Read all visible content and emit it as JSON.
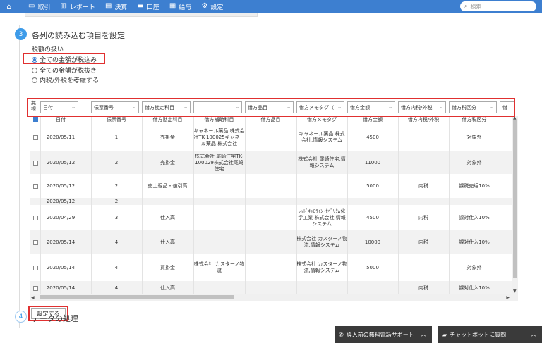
{
  "nav": {
    "items": [
      {
        "icon": "screen-icon",
        "glyph": "▭",
        "label": "取引"
      },
      {
        "icon": "report-icon",
        "glyph": "▥",
        "label": "レポート"
      },
      {
        "icon": "book-icon",
        "glyph": "▤",
        "label": "決算"
      },
      {
        "icon": "card-icon",
        "glyph": "▬",
        "label": "口座"
      },
      {
        "icon": "doc-icon",
        "glyph": "▦",
        "label": "給与"
      },
      {
        "icon": "gear-icon",
        "glyph": "⚙",
        "label": "設定"
      }
    ],
    "search_placeholder": "検索"
  },
  "step3": {
    "number": "3",
    "title": "各列の読み込む項目を設定"
  },
  "tax": {
    "label": "税額の扱い",
    "options": [
      "全ての金額が税込み",
      "全ての金額が税抜き",
      "内税/外税を考慮する"
    ],
    "selected": 0
  },
  "table": {
    "mu_label": "無視",
    "filters": [
      "日付",
      "伝票番号",
      "借方勘定科目",
      "",
      "借方品目",
      "借方メモタグ（",
      "借方金額",
      "借方内税/外税",
      "借方税区分",
      "借"
    ],
    "headers": [
      "日付",
      "伝票番号",
      "借方勘定科目",
      "借方補助科目",
      "借方品目",
      "借方メモタグ",
      "借方金額",
      "借方内税/外税",
      "借方税区分"
    ],
    "rows": [
      {
        "cells": [
          "2020/05/11",
          "1",
          "売掛金",
          "キャネール薬品 株式会社TK-100025キャネール薬品 株式会社",
          "",
          "キャネール薬品 株式会社,情報システム",
          "4500",
          "",
          "対象外"
        ]
      },
      {
        "cells": [
          "2020/05/12",
          "2",
          "売掛金",
          "株式会社 尾崎住宅TK-100029株式会社尾崎住宅",
          "",
          "株式会社 尾崎住宅,情報システム",
          "11000",
          "",
          "対象外"
        ]
      },
      {
        "cells": [
          "2020/05/12",
          "2",
          "売上返品・値引高",
          "",
          "",
          "",
          "5000",
          "内税",
          "課税売返10%"
        ]
      },
      {
        "cells": [
          "2020/05/12",
          "2",
          "",
          "",
          "",
          "",
          "",
          "",
          ""
        ]
      },
      {
        "cells": [
          "2020/04/29",
          "3",
          "仕入高",
          "",
          "",
          "ﾚｯﾄﾞｷｬﾛﾗｲﾝ･ｾﾍﾞﾘﾀﾑ化学工業 株式会社,情報システム",
          "4500",
          "内税",
          "課対仕入10%"
        ]
      },
      {
        "cells": [
          "2020/05/14",
          "4",
          "仕入高",
          "",
          "",
          "株式会社 カスターノ物流,情報システム",
          "10000",
          "内税",
          "課対仕入10%"
        ]
      },
      {
        "cells": [
          "2020/05/14",
          "4",
          "買掛金",
          "株式会社 カスターノ物流",
          "",
          "株式会社 カスターノ物流,情報システム",
          "5000",
          "",
          "対象外"
        ]
      },
      {
        "cells": [
          "2020/05/14",
          "4",
          "仕入高",
          "",
          "",
          "",
          "",
          "内税",
          "課対仕入10%"
        ]
      }
    ]
  },
  "set_button": "設定する",
  "step4": {
    "number": "4",
    "title": "データの処理"
  },
  "support": "導入前の無料電話サポート",
  "chat": "チャットボットに質問"
}
